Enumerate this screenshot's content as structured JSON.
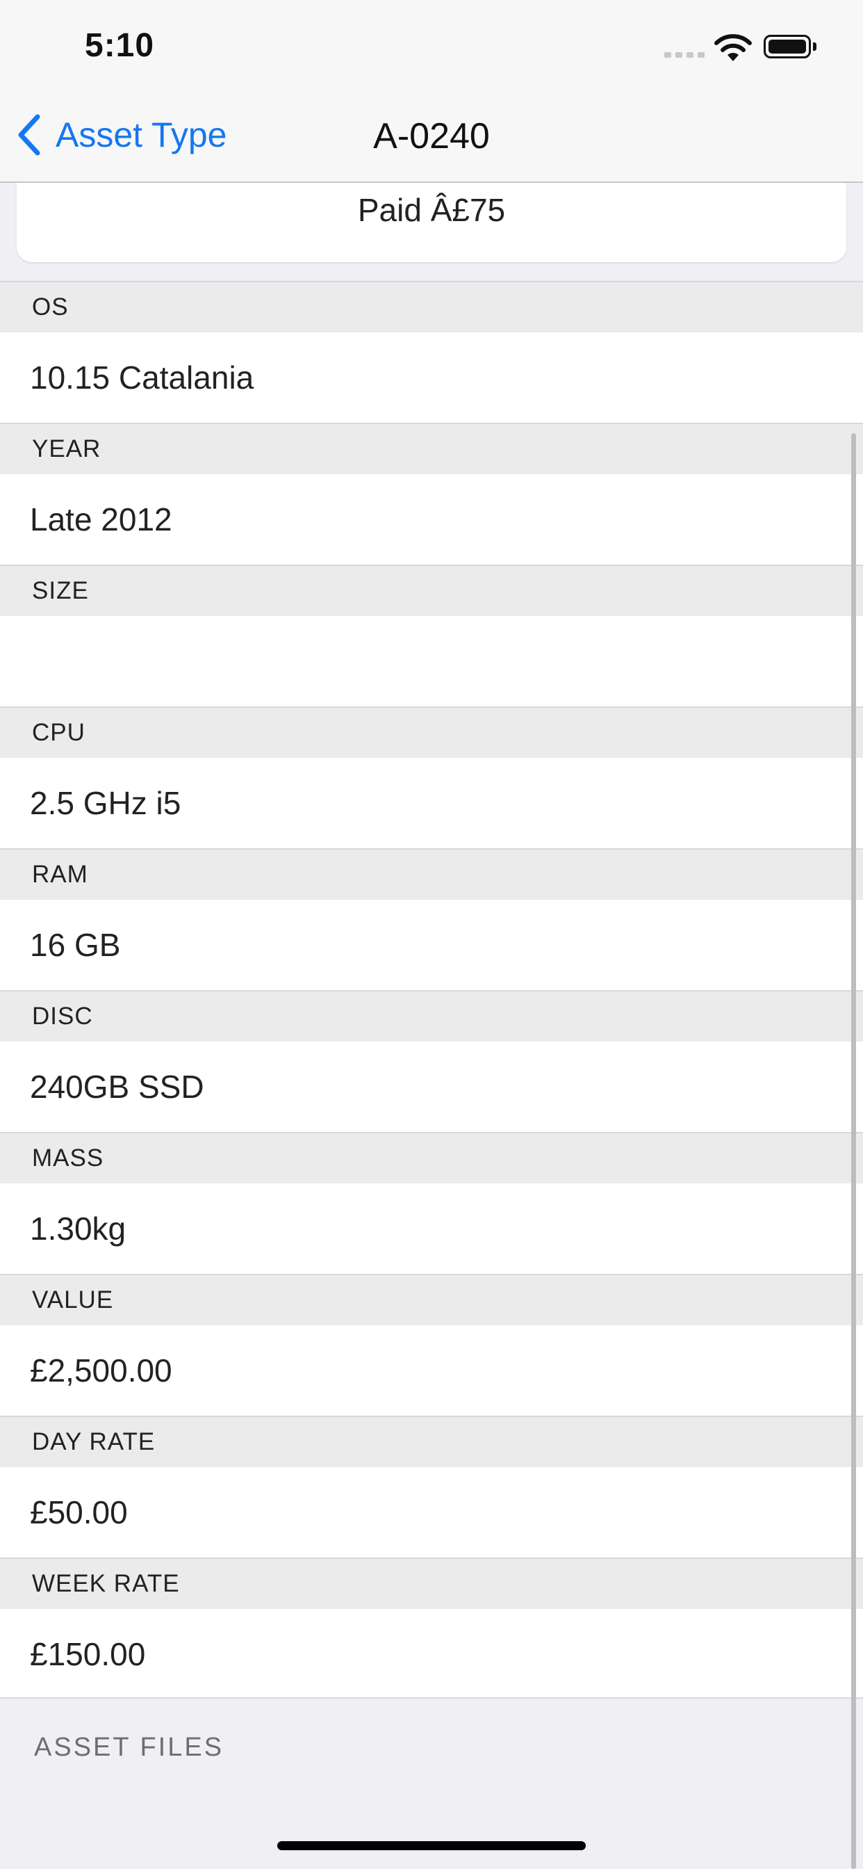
{
  "status_bar": {
    "time": "5:10"
  },
  "nav": {
    "back_label": "Asset Type",
    "title": "A-0240"
  },
  "paid_text": "Paid Â£75",
  "fields": [
    {
      "label": "OS",
      "value": "10.15 Catalania"
    },
    {
      "label": "YEAR",
      "value": "Late 2012"
    },
    {
      "label": "SIZE",
      "value": ""
    },
    {
      "label": "CPU",
      "value": "2.5 GHz i5"
    },
    {
      "label": "RAM",
      "value": "16 GB"
    },
    {
      "label": "DISC",
      "value": "240GB SSD"
    },
    {
      "label": "MASS",
      "value": "1.30kg"
    },
    {
      "label": "VALUE",
      "value": "£2,500.00"
    },
    {
      "label": "DAY RATE",
      "value": "£50.00"
    },
    {
      "label": "WEEK RATE",
      "value": "£150.00"
    }
  ],
  "section_footer": "ASSET FILES",
  "colors": {
    "accent": "#1577f2",
    "header_bg": "#ebebeb",
    "page_bg": "#efeff4"
  },
  "icons": {
    "back": "chevron-left-icon",
    "wifi": "wifi-icon",
    "battery": "battery-icon",
    "signal": "cellular-signal-icon"
  }
}
